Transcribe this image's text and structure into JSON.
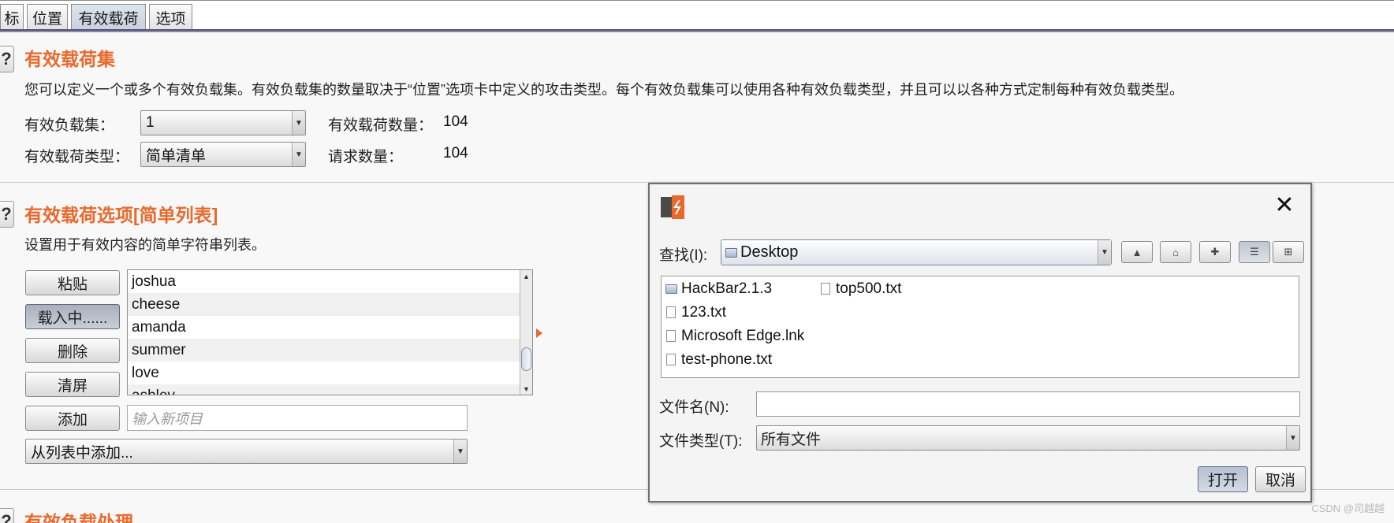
{
  "tabs": [
    "标",
    "位置",
    "有效载荷",
    "选项"
  ],
  "active_tab": 2,
  "payload_sets": {
    "title": "有效载荷集",
    "description": "您可以定义一个或多个有效负载集。有效负载集的数量取决于“位置”选项卡中定义的攻击类型。每个有效负载集可以使用各种有效负载类型，并且可以以各种方式定制每种有效负载类型。",
    "set_label": "有效负载集：",
    "set_value": "1",
    "type_label": "有效载荷类型：",
    "type_value": "简单清单",
    "count_label": "有效载荷数量：",
    "count_value": "104",
    "request_label": "请求数量：",
    "request_value": "104"
  },
  "payload_options": {
    "title": "有效载荷选项[简单列表]",
    "description": "设置用于有效内容的简单字符串列表。",
    "buttons": {
      "paste": "粘贴",
      "load": "载入中......",
      "remove": "删除",
      "clear": "清屏",
      "add": "添加"
    },
    "items": [
      "joshua",
      "cheese",
      "amanda",
      "summer",
      "love",
      "ashley"
    ],
    "new_item_placeholder": "输入新项目",
    "add_from_list": "从列表中添加..."
  },
  "payload_processing": {
    "title": "有效负载处理"
  },
  "file_dialog": {
    "look_in_label": "查找(I):",
    "look_in_value": "Desktop",
    "files_col1": [
      "HackBar2.1.3",
      "123.txt",
      "Microsoft Edge.lnk",
      "test-phone.txt"
    ],
    "files_col2": [
      "top500.txt"
    ],
    "file_name_label": "文件名(N):",
    "file_name_value": "",
    "file_type_label": "文件类型(T):",
    "file_type_value": "所有文件",
    "open_button": "打开",
    "cancel_button": "取消",
    "logo_color": "#e8692c"
  },
  "watermark": "CSDN @司越越",
  "colors": {
    "accent": "#e8692c",
    "background": "#f8f8f8"
  }
}
